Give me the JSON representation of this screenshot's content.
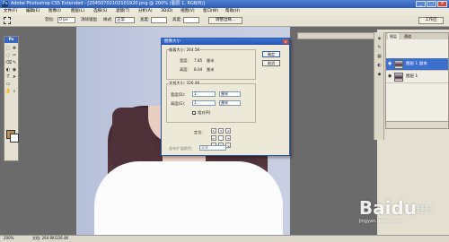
{
  "app": {
    "title": "Adobe Photoshop CS5 Extended - [20450702102101920.png @ 200% (图层 1, RGB/8)]",
    "logo": "Ps",
    "window_buttons": [
      "_",
      "□",
      "×"
    ]
  },
  "menu": [
    "文件(F)",
    "编辑(E)",
    "图像(I)",
    "图层(L)",
    "选择(S)",
    "滤镜(T)",
    "分析(A)",
    "3D(D)",
    "视图(V)",
    "窗口(W)",
    "帮助(H)"
  ],
  "options": {
    "feather_label": "羽化:",
    "feather_value": "0 px",
    "antialias_label": "消除锯齿",
    "style_label": "样式:",
    "style_value": "正常",
    "width_label": "宽度:",
    "height_label": "高度:",
    "refine_edge": "调整边缘...",
    "workspace": "工作区"
  },
  "toolbox": {
    "header": "Ps",
    "tools": [
      "⬚",
      "✥",
      "◌",
      "✂",
      "⌫",
      "✎",
      "◐",
      "◉",
      "T",
      "➤",
      "▭",
      "✋",
      "⌕"
    ]
  },
  "dialog": {
    "title": "图像大小",
    "pixel_dim_label": "像素大小: 264.5K",
    "doc_size_label": "文档大小: 326.4K",
    "width_label": "宽度:",
    "width_value": "7.85",
    "width_unit": "厘米",
    "height_label": "高度:",
    "height_value": "8.04",
    "height_unit": "厘米",
    "doc_width_label": "宽度(D):",
    "doc_width_value": "1",
    "doc_width_unit": "厘米",
    "doc_height_label": "高度(G):",
    "doc_height_value": "1",
    "doc_height_unit": "厘米",
    "relative_label": "相对(R)",
    "relative_checked": true,
    "anchor_label": "定位:",
    "extension_label": "画布扩展颜色:",
    "extension_value": "背景",
    "ok_label": "确定",
    "cancel_label": "取消"
  },
  "panels": {
    "layers_tabs": [
      "图层",
      "通道"
    ],
    "layers": [
      {
        "name": "图层 1 副本",
        "selected": true
      },
      {
        "name": "图层 1",
        "selected": false
      }
    ]
  },
  "status": {
    "zoom": "200%",
    "doc": "文档: 264.9K/326.4K"
  },
  "watermark": {
    "text": "Baidu",
    "suffix": "经验",
    "sub": "jingyan.baidu.com"
  },
  "colors": {
    "title_bar": "#2c5db8",
    "selected_layer": "#3d6fcf",
    "foreground": "#b98a5a"
  }
}
